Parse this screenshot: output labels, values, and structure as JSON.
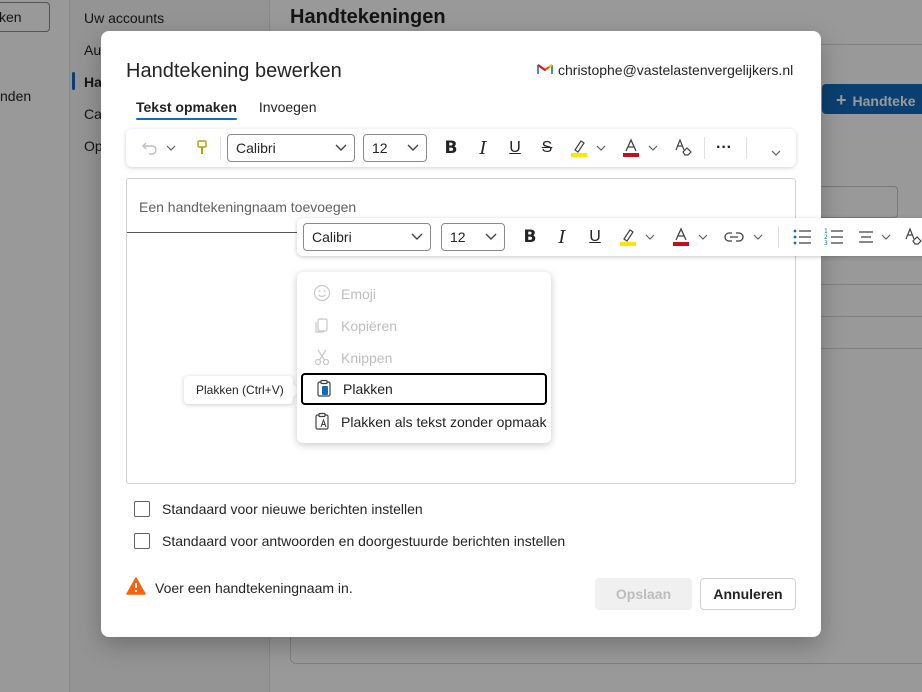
{
  "background": {
    "search_label": "ken",
    "left_text": "nden",
    "nav_items": [
      "Uw accounts",
      "Au",
      "Ha",
      "Ca",
      "Op"
    ],
    "main_title": "Handtekeningen",
    "new_button": "Handteke"
  },
  "dialog": {
    "title": "Handtekening bewerken",
    "account_email": "christophe@vastelastenvergelijkers.nl",
    "tabs": [
      {
        "label": "Tekst opmaken",
        "active": true
      },
      {
        "label": "Invoegen",
        "active": false
      }
    ],
    "toolbar": {
      "font": "Calibri",
      "size": "12"
    },
    "editor": {
      "name_placeholder": "Een handtekeningnaam toevoegen"
    },
    "checkboxes": [
      {
        "label": "Standaard voor nieuwe berichten instellen",
        "checked": false
      },
      {
        "label": "Standaard voor antwoorden en doorgestuurde berichten instellen",
        "checked": false
      }
    ],
    "warning": "Voer een handtekeningnaam in.",
    "save_label": "Opslaan",
    "cancel_label": "Annuleren"
  },
  "float_toolbar": {
    "font": "Calibri",
    "size": "12"
  },
  "context_menu": {
    "items": [
      {
        "label": "Emoji",
        "icon": "emoji-icon",
        "disabled": true
      },
      {
        "label": "Kopiëren",
        "icon": "copy-icon",
        "disabled": true
      },
      {
        "label": "Knippen",
        "icon": "cut-icon",
        "disabled": true
      },
      {
        "label": "Plakken",
        "icon": "paste-icon",
        "disabled": false,
        "focused": true
      },
      {
        "label": "Plakken als tekst zonder opmaak",
        "icon": "paste-text-icon",
        "disabled": false
      }
    ]
  },
  "tooltip": "Plakken (Ctrl+V)",
  "colors": {
    "accent": "#0f6cbd",
    "highlight": "#ffe600",
    "font_color": "#c50f1f",
    "warning": "#f7630c"
  }
}
